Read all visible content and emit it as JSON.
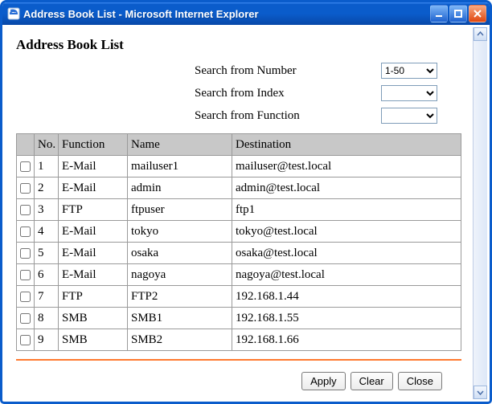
{
  "window": {
    "title": "Address Book List - Microsoft Internet Explorer"
  },
  "page": {
    "heading": "Address Book List"
  },
  "filters": {
    "number_label": "Search from Number",
    "number_value": "1-50",
    "index_label": "Search from Index",
    "index_value": "",
    "function_label": "Search from Function",
    "function_value": ""
  },
  "table": {
    "headers": {
      "no": "No.",
      "function": "Function",
      "name": "Name",
      "destination": "Destination"
    },
    "rows": [
      {
        "no": "1",
        "function": "E-Mail",
        "name": "mailuser1",
        "destination": "mailuser@test.local"
      },
      {
        "no": "2",
        "function": "E-Mail",
        "name": "admin",
        "destination": "admin@test.local"
      },
      {
        "no": "3",
        "function": "FTP",
        "name": "ftpuser",
        "destination": "ftp1"
      },
      {
        "no": "4",
        "function": "E-Mail",
        "name": "tokyo",
        "destination": "tokyo@test.local"
      },
      {
        "no": "5",
        "function": "E-Mail",
        "name": "osaka",
        "destination": "osaka@test.local"
      },
      {
        "no": "6",
        "function": "E-Mail",
        "name": "nagoya",
        "destination": "nagoya@test.local"
      },
      {
        "no": "7",
        "function": "FTP",
        "name": "FTP2",
        "destination": "192.168.1.44"
      },
      {
        "no": "8",
        "function": "SMB",
        "name": "SMB1",
        "destination": "192.168.1.55"
      },
      {
        "no": "9",
        "function": "SMB",
        "name": "SMB2",
        "destination": "192.168.1.66"
      }
    ]
  },
  "buttons": {
    "apply": "Apply",
    "clear": "Clear",
    "close": "Close"
  }
}
